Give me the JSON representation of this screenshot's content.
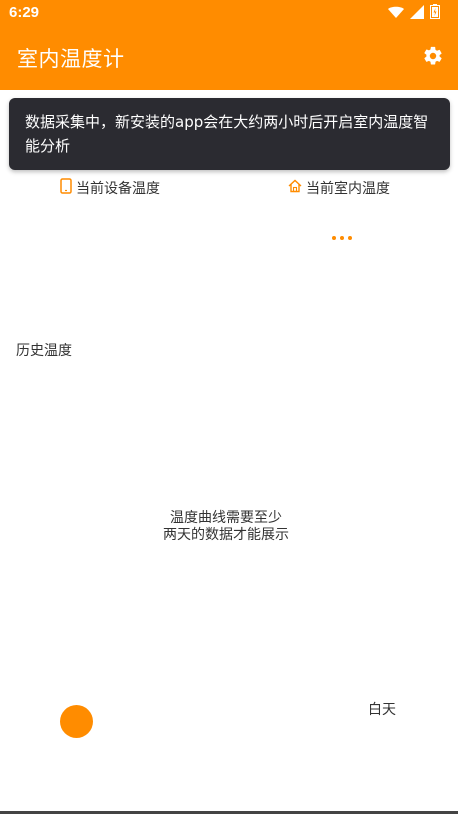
{
  "status_bar": {
    "time": "6:29",
    "icons": [
      "wifi-icon",
      "signal-icon",
      "battery-icon"
    ]
  },
  "app_bar": {
    "title": "室内温度计",
    "settings_icon": "gear-icon"
  },
  "toast": {
    "message": "数据采集中，新安装的app会在大约两小时后开启室内温度智能分析"
  },
  "current": {
    "device_label": "当前设备温度",
    "indoor_label": "当前室内温度",
    "device_icon": "phone-icon",
    "indoor_icon": "home-icon"
  },
  "history": {
    "title": "历史温度",
    "empty_line1": "温度曲线需要至少",
    "empty_line2": "两天的数据才能展示",
    "day_label": "白天"
  },
  "colors": {
    "brand": "#FF8C00",
    "toast_bg": "#2B2B31",
    "text": "#333333"
  }
}
